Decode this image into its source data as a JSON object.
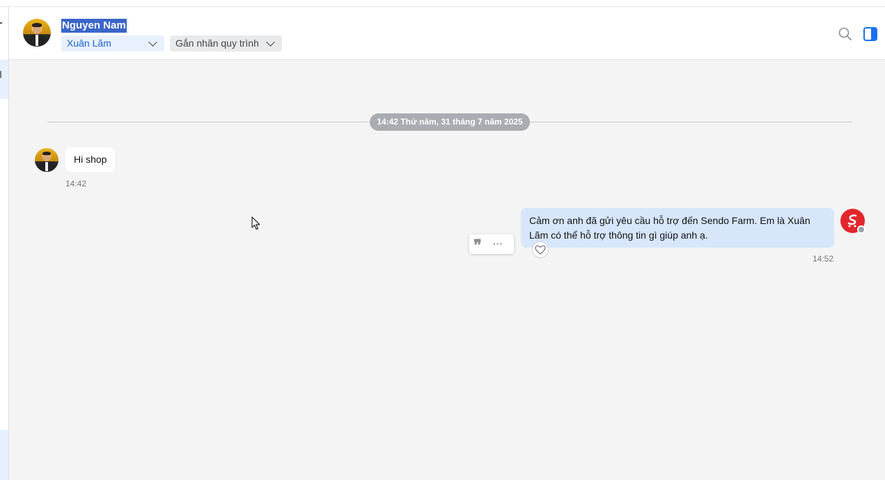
{
  "header": {
    "contact_name": "Nguyen Nam",
    "assignee": "Xuân Lãm",
    "tag_placeholder": "Gắn nhãn quy trình",
    "icons": [
      "search-icon",
      "side-panel-icon",
      "chevron-down-icon"
    ]
  },
  "chat": {
    "date_separator": "14:42 Thứ năm, 31 tháng 7 năm 2025",
    "messages": [
      {
        "direction": "incoming",
        "text": "Hi shop",
        "time": "14:42"
      },
      {
        "direction": "outgoing",
        "text": "Cảm ơn anh đã gửi yêu cầu hỗ trợ đến Sendo Farm. Em là Xuân Lãm có thể hỗ trợ thông tin gì giúp anh ạ.",
        "time": "14:52"
      }
    ],
    "message_actions": [
      "quote-icon",
      "more-icon"
    ],
    "reaction_icon": "heart-icon"
  },
  "colors": {
    "accent": "#1a5fd0",
    "outgoing_bubble": "#d7e6fb",
    "chat_background": "#f4f4f4",
    "brand_avatar": "#e3262b",
    "selection_highlight": "#3a66c9"
  }
}
